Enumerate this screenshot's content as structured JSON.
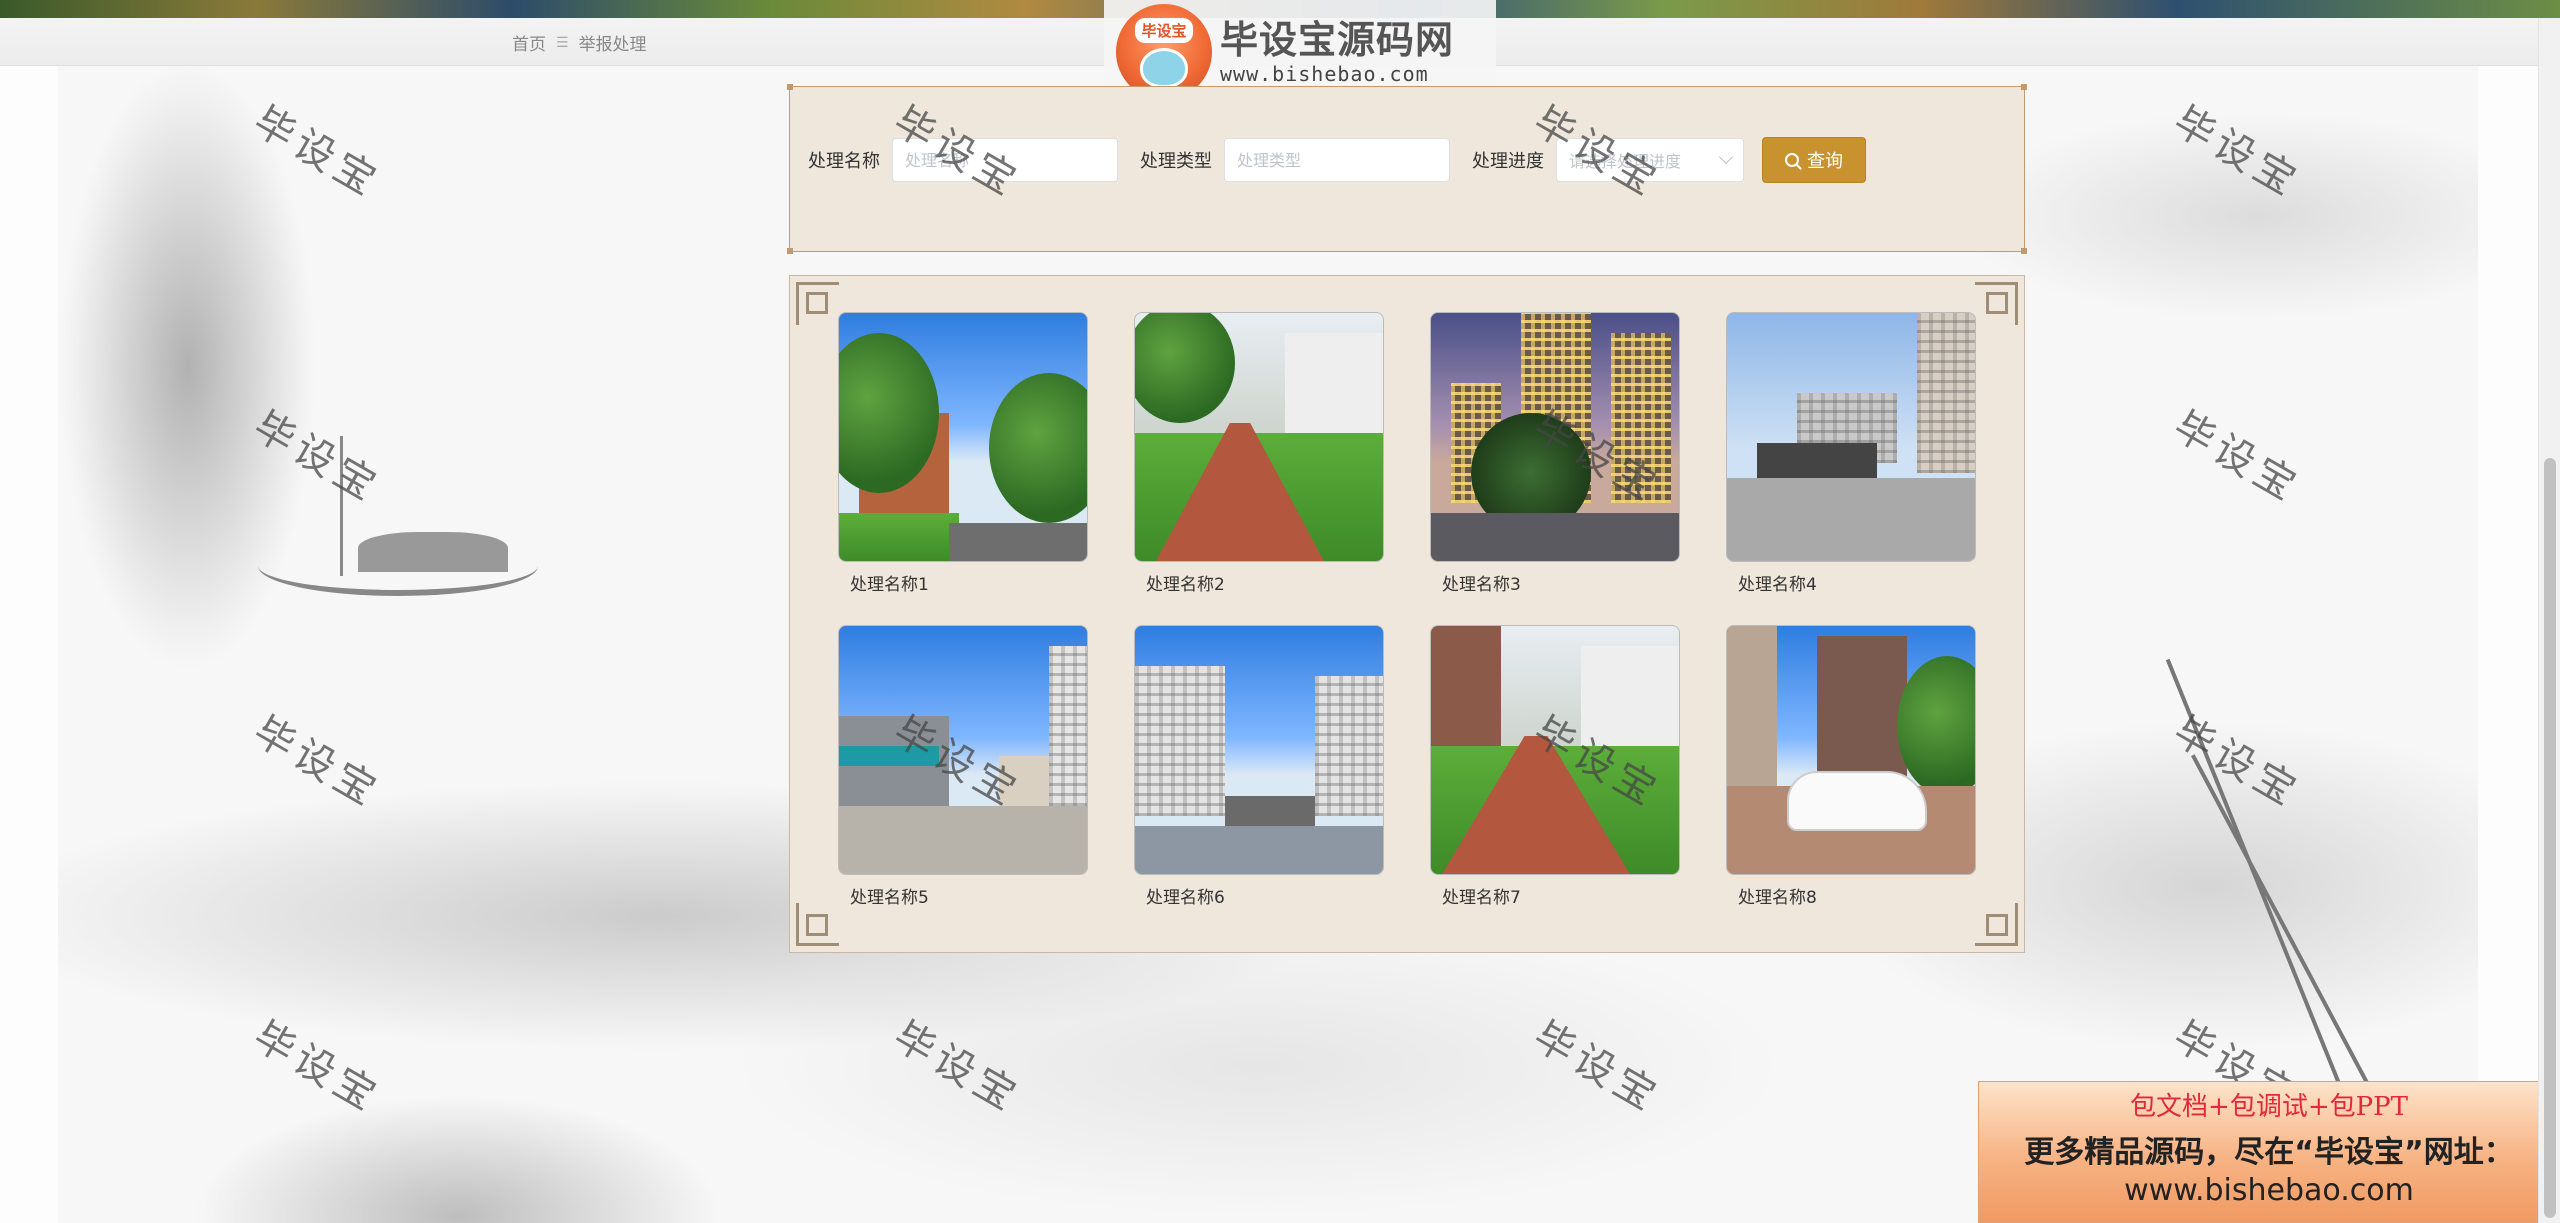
{
  "breadcrumb": {
    "home": "首页",
    "separator": "☰",
    "current": "举报处理"
  },
  "logo": {
    "badge": "毕设宝",
    "title": "毕设宝源码网",
    "url": "www.bishebao.com"
  },
  "watermark_text": "毕设宝",
  "search": {
    "name_label": "处理名称",
    "name_placeholder": "处理名称",
    "type_label": "处理类型",
    "type_placeholder": "处理类型",
    "progress_label": "处理进度",
    "progress_placeholder": "请选择处理进度",
    "button_label": "查询"
  },
  "items": [
    {
      "caption": "处理名称1"
    },
    {
      "caption": "处理名称2"
    },
    {
      "caption": "处理名称3"
    },
    {
      "caption": "处理名称4"
    },
    {
      "caption": "处理名称5"
    },
    {
      "caption": "处理名称6"
    },
    {
      "caption": "处理名称7"
    },
    {
      "caption": "处理名称8"
    }
  ],
  "promo": {
    "line1": "包文档+包调试+包PPT",
    "line2": "更多精品源码，尽在“毕设宝”网址：",
    "line3": "www.bishebao.com"
  },
  "colors": {
    "accent": "#c8932f",
    "panel": "#efe7dc",
    "panel_border": "#c49a6c"
  }
}
